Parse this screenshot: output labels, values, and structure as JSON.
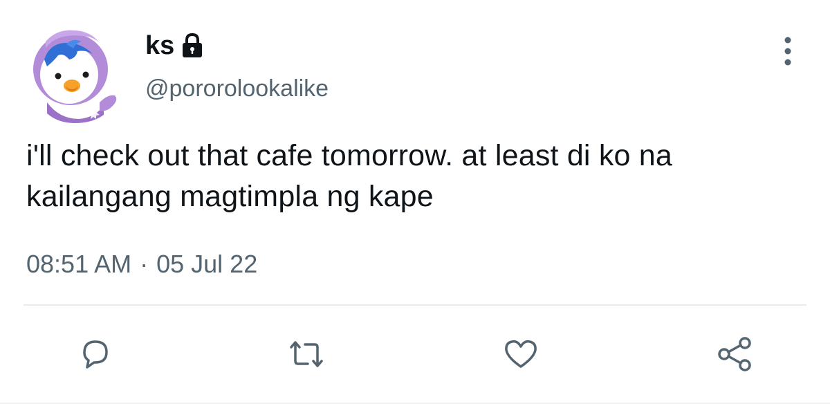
{
  "tweet": {
    "display_name": "ks",
    "handle": "@pororolookalike",
    "text": "i'll check out that cafe tomorrow. at least di ko na kailangang magtimpla ng kape",
    "time": "08:51 AM",
    "separator": "·",
    "date": "05 Jul 22",
    "protected": true
  },
  "icons": {
    "avatar": "penguin-avatar",
    "lock": "lock-icon",
    "more": "vertical-ellipsis-icon",
    "reply": "reply-icon",
    "retweet": "retweet-icon",
    "like": "heart-icon",
    "share": "share-icon"
  },
  "colors": {
    "text_primary": "#0f1419",
    "text_secondary": "#536471",
    "icon": "#536471",
    "divider": "#e6ecf0"
  }
}
